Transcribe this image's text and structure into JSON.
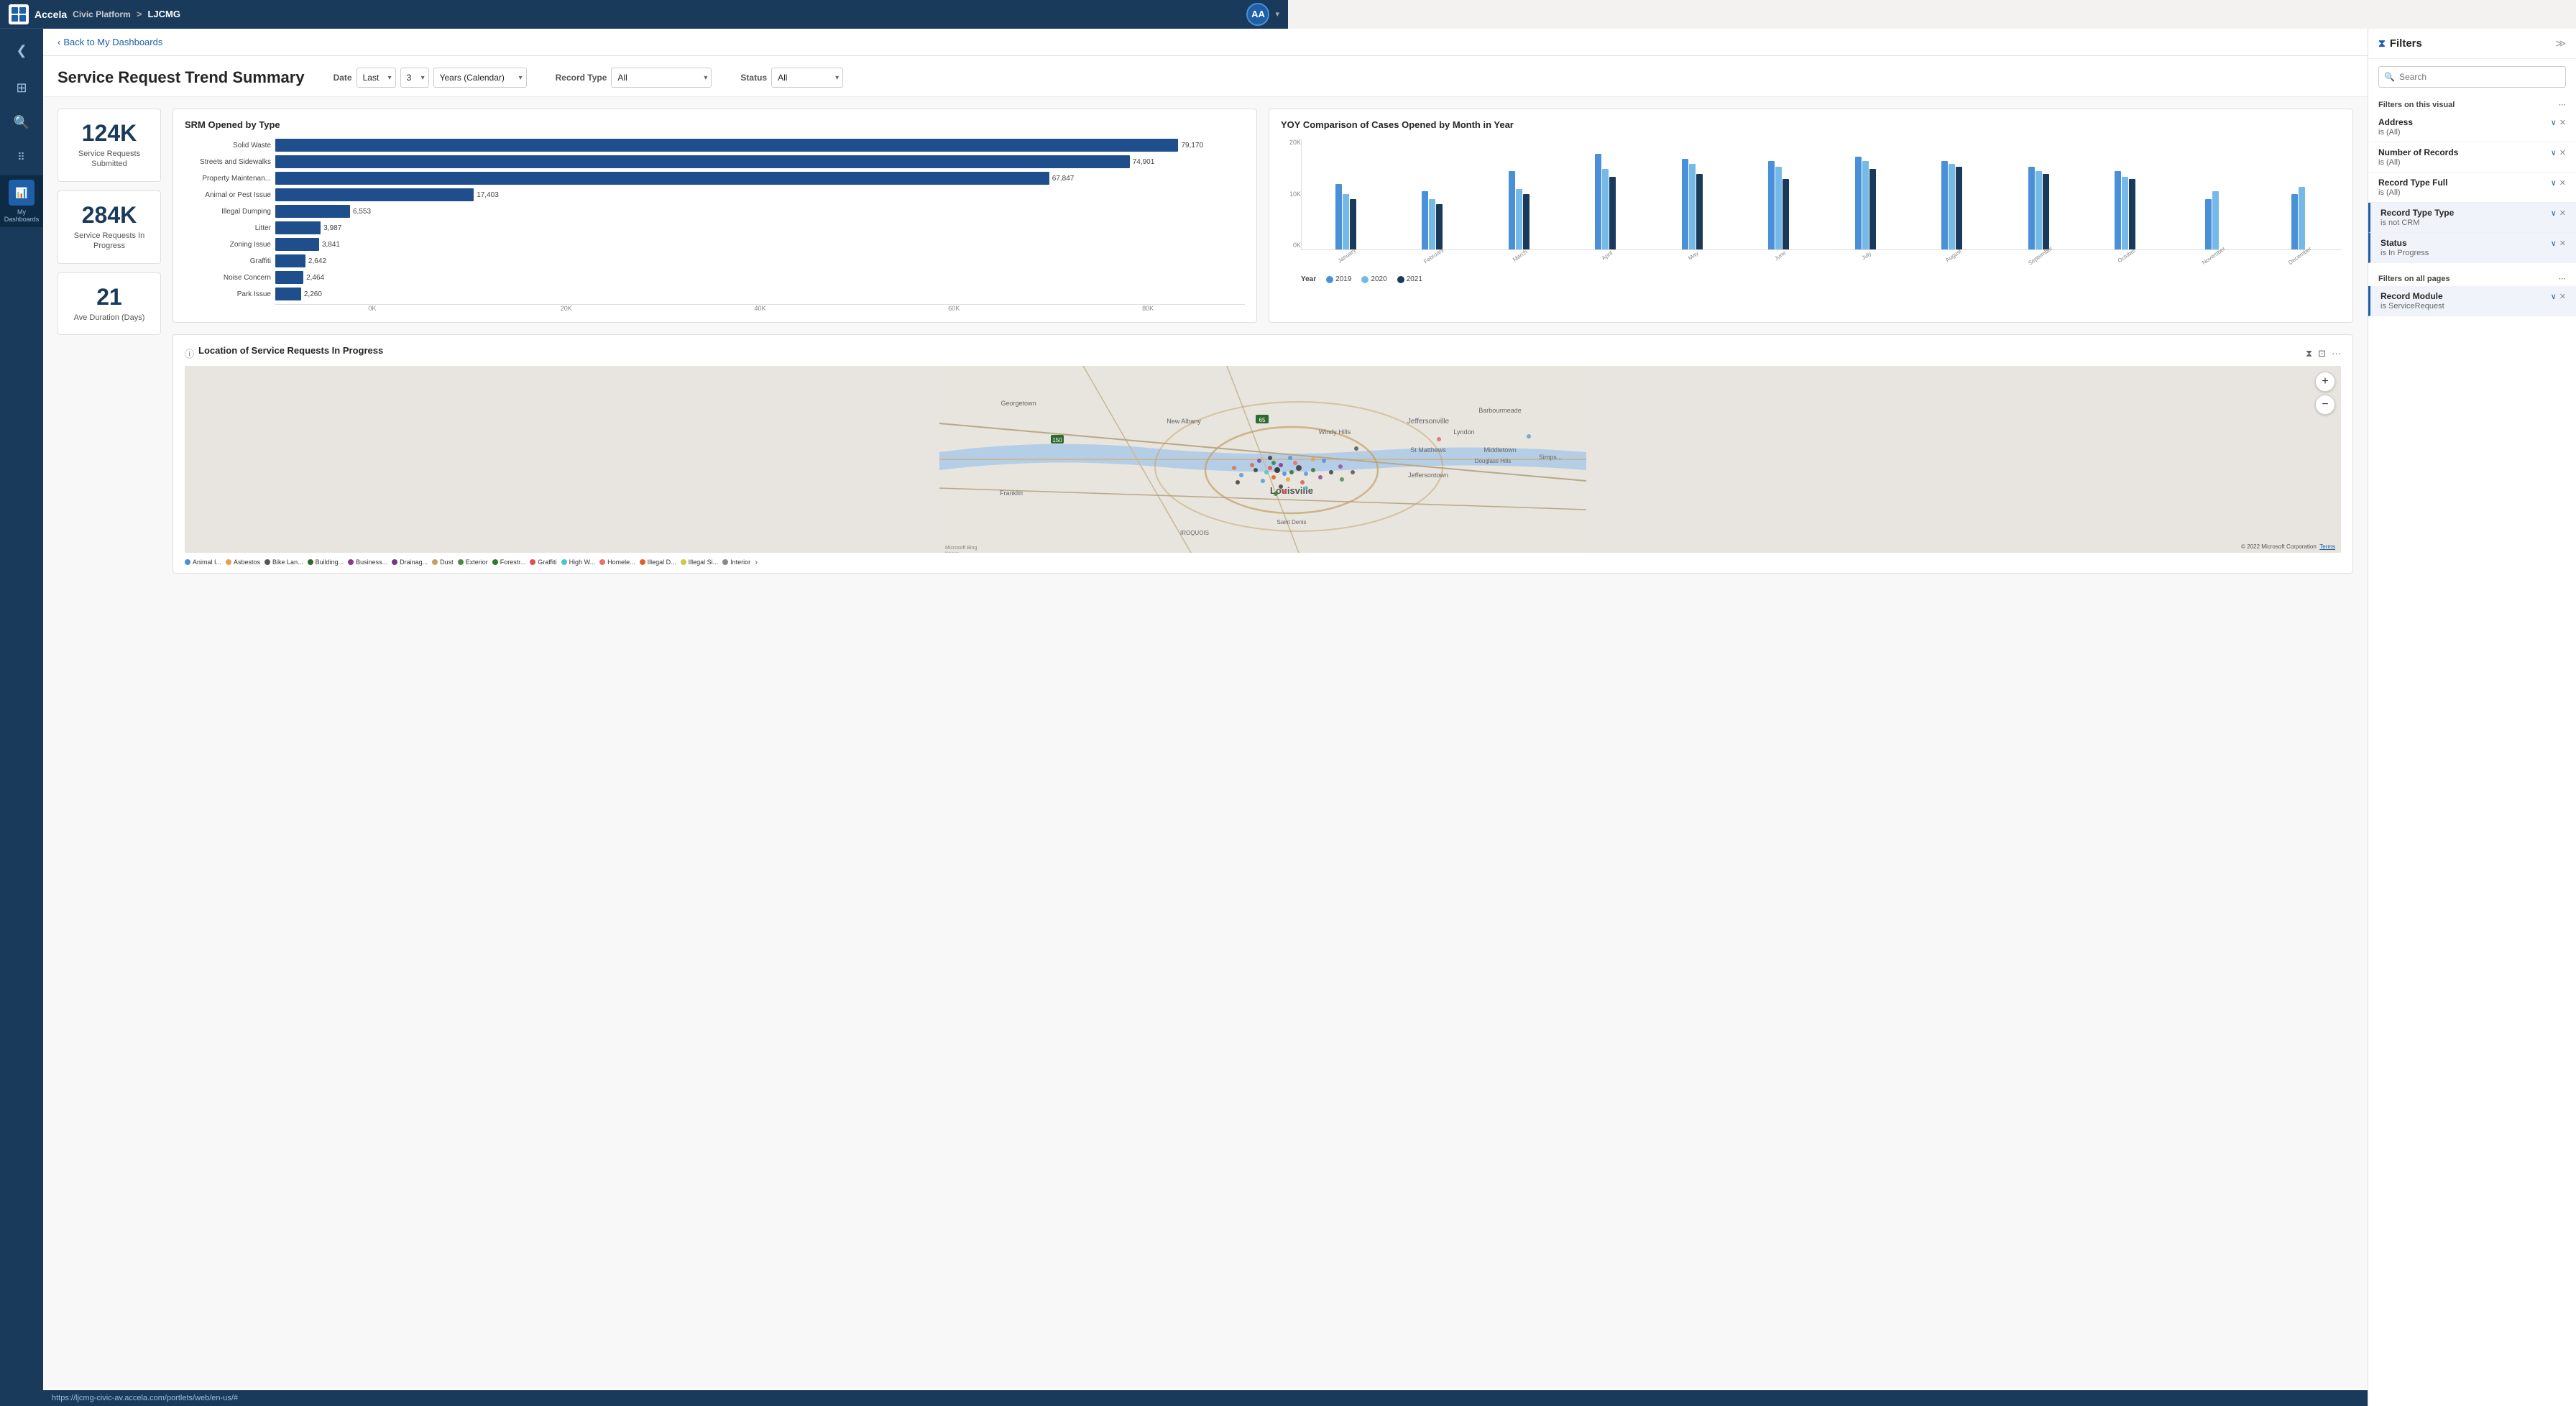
{
  "app": {
    "name": "Accela",
    "platform": "Civic Platform",
    "separator": ">",
    "instance": "LJCMG",
    "user_initials": "AA"
  },
  "sidebar": {
    "collapse_icon": "❮",
    "items": [
      {
        "id": "grid",
        "icon": "⊞",
        "label": ""
      },
      {
        "id": "search",
        "icon": "🔍",
        "label": ""
      },
      {
        "id": "apps",
        "icon": "⋮⋮⋮",
        "label": ""
      },
      {
        "id": "dashboards",
        "icon": "📊",
        "label": "My\nDashboards",
        "active": true
      }
    ]
  },
  "back_link": "Back to My Dashboards",
  "page": {
    "title": "Service Request Trend Summary",
    "filters": {
      "date_label": "Date",
      "date_option": "Last",
      "date_num": "3",
      "date_period": "Years (Calendar)",
      "record_type_label": "Record Type",
      "record_type_value": "All",
      "status_label": "Status",
      "status_value": "All"
    }
  },
  "stats": [
    {
      "number": "124K",
      "label": "Service Requests Submitted"
    },
    {
      "number": "284K",
      "label": "Service Requests In Progress"
    },
    {
      "number": "21",
      "label": "Ave Duration (Days)"
    }
  ],
  "srm_chart": {
    "title": "SRM Opened by Type",
    "bars": [
      {
        "label": "Solid Waste",
        "value": 79170,
        "max": 85000
      },
      {
        "label": "Streets and Sidewalks",
        "value": 74901,
        "max": 85000
      },
      {
        "label": "Property Maintenan...",
        "value": 67847,
        "max": 85000
      },
      {
        "label": "Animal or Pest Issue",
        "value": 17403,
        "max": 85000
      },
      {
        "label": "Illegal Dumping",
        "value": 6553,
        "max": 85000
      },
      {
        "label": "Litter",
        "value": 3987,
        "max": 85000
      },
      {
        "label": "Zoning Issue",
        "value": 3841,
        "max": 85000
      },
      {
        "label": "Graffiti",
        "value": 2642,
        "max": 85000
      },
      {
        "label": "Noise Concern",
        "value": 2464,
        "max": 85000
      },
      {
        "label": "Park Issue",
        "value": 2260,
        "max": 85000
      }
    ],
    "axis_labels": [
      "0K",
      "20K",
      "40K",
      "60K",
      "80K"
    ]
  },
  "yoy_chart": {
    "title": "YOY Comparison of Cases Opened by Month in Year",
    "y_labels": [
      "20K",
      "10K",
      "0K"
    ],
    "months": [
      "January",
      "February",
      "March",
      "April",
      "May",
      "June",
      "July",
      "August",
      "September",
      "October",
      "November",
      "December"
    ],
    "years": [
      {
        "year": "2019",
        "color": "#4a90d9",
        "values": [
          65,
          58,
          78,
          95,
          90,
          88,
          92,
          88,
          82,
          78,
          50,
          55
        ]
      },
      {
        "year": "2020",
        "color": "#74b9e8",
        "values": [
          55,
          50,
          60,
          80,
          85,
          82,
          88,
          85,
          78,
          72,
          58,
          62
        ]
      },
      {
        "year": "2021",
        "color": "#1a3a5c",
        "values": [
          50,
          45,
          55,
          72,
          75,
          70,
          80,
          82,
          75,
          70,
          0,
          0
        ]
      }
    ],
    "legend_label": "Year"
  },
  "map": {
    "title": "Location of Service Requests In Progress",
    "legend": [
      {
        "label": "Animal I...",
        "color": "#4a90d9"
      },
      {
        "label": "Asbestos",
        "color": "#e8a04a"
      },
      {
        "label": "Bike Lan...",
        "color": "#555"
      },
      {
        "label": "Building...",
        "color": "#2d6a2d"
      },
      {
        "label": "Business...",
        "color": "#8b3a8b"
      },
      {
        "label": "Drainag...",
        "color": "#8b3a8b"
      },
      {
        "label": "Dust",
        "color": "#c8a060"
      },
      {
        "label": "Exterior",
        "color": "#4a8b4a"
      },
      {
        "label": "Forestr...",
        "color": "#2d7a2d"
      },
      {
        "label": "Graffiti",
        "color": "#e05050"
      },
      {
        "label": "High W...",
        "color": "#4ac8c8"
      },
      {
        "label": "Homele...",
        "color": "#e87070"
      },
      {
        "label": "Illegal D...",
        "color": "#e06030"
      },
      {
        "label": "Illegal Si...",
        "color": "#d4c840"
      },
      {
        "label": "Interior",
        "color": "#888"
      }
    ],
    "copyright": "© 2022 Microsoft Corporation",
    "bing_label": "Microsoft Bing"
  },
  "filters_panel": {
    "title": "Filters",
    "search_placeholder": "Search",
    "visual_section": "Filters on this visual",
    "all_pages_section": "Filters on all pages",
    "visual_filters": [
      {
        "name": "Address",
        "sub": "is (All)",
        "expanded": true
      },
      {
        "name": "Number of Records",
        "sub": "is (All)",
        "expanded": true
      },
      {
        "name": "Record Type Full",
        "sub": "is (All)",
        "expanded": true
      },
      {
        "name": "Record Type Type",
        "sub": "is not CRM",
        "expanded": true,
        "accent": true
      },
      {
        "name": "Status",
        "sub": "is In Progress",
        "expanded": true,
        "accent": true
      }
    ],
    "page_filters": [
      {
        "name": "Record Module",
        "sub": "is ServiceRequest",
        "expanded": true,
        "accent": true
      }
    ]
  },
  "status_bar": {
    "url": "https://ljcmg-civic-av.accela.com/portlets/web/en-us/#"
  }
}
